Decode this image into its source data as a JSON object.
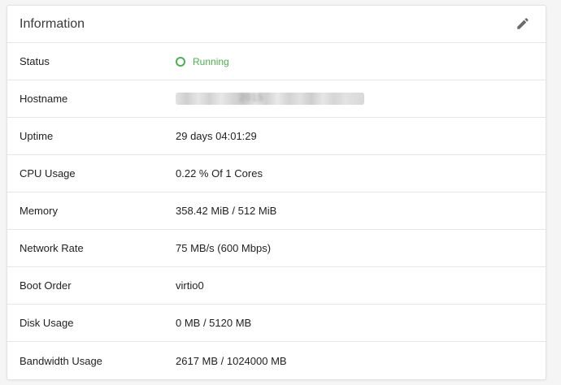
{
  "header": {
    "title": "Information",
    "edit_icon": "pencil-icon"
  },
  "rows": [
    {
      "label": "Status",
      "value": "Running",
      "status_color": "#4caf50"
    },
    {
      "label": "Hostname",
      "value": "2015"
    },
    {
      "label": "Uptime",
      "value": "29 days 04:01:29"
    },
    {
      "label": "CPU Usage",
      "value": "0.22 % Of 1 Cores"
    },
    {
      "label": "Memory",
      "value": "358.42 MiB / 512 MiB"
    },
    {
      "label": "Network Rate",
      "value": "75 MB/s (600 Mbps)"
    },
    {
      "label": "Boot Order",
      "value": "virtio0"
    },
    {
      "label": "Disk Usage",
      "value": "0 MB / 5120 MB"
    },
    {
      "label": "Bandwidth Usage",
      "value": "2617 MB / 1024000 MB"
    }
  ]
}
